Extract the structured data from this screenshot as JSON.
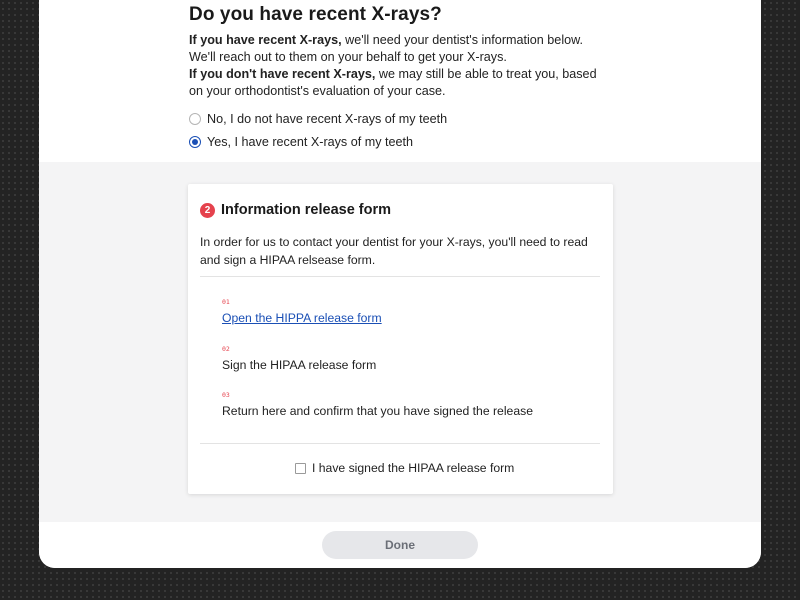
{
  "question": {
    "title": "Do you have recent X-rays?",
    "intro_yes_bold": "If you have recent X-rays,",
    "intro_yes_rest": " we'll need your dentist's information below. We'll reach out to them on your behalf to get your X-rays.",
    "intro_no_bold": "If you don't have recent X-rays,",
    "intro_no_rest": " we may still be able to treat you, based on your orthodontist's evaluation of your case."
  },
  "options": [
    {
      "label": "No, I do not have recent X-rays of my teeth",
      "selected": false
    },
    {
      "label": "Yes, I have recent X-rays of my teeth",
      "selected": true
    }
  ],
  "release_card": {
    "step_number": "2",
    "title": "Information release form",
    "description": "In order for us to contact your dentist for your X-rays, you'll need to read and sign a HIPAA relsease form.",
    "steps": [
      {
        "num": "01",
        "text": "Open the HIPPA release form",
        "is_link": true
      },
      {
        "num": "02",
        "text": "Sign the HIPAA release form",
        "is_link": false
      },
      {
        "num": "03",
        "text": "Return here and confirm that you have signed the release",
        "is_link": false
      }
    ],
    "confirm_label": "I have signed the HIPAA release form",
    "confirm_checked": false
  },
  "footer": {
    "done_label": "Done"
  },
  "colors": {
    "accent_red": "#e5424d",
    "link_blue": "#1a4fb5",
    "panel_gray": "#f4f4f5",
    "button_gray": "#e6e7ea"
  }
}
